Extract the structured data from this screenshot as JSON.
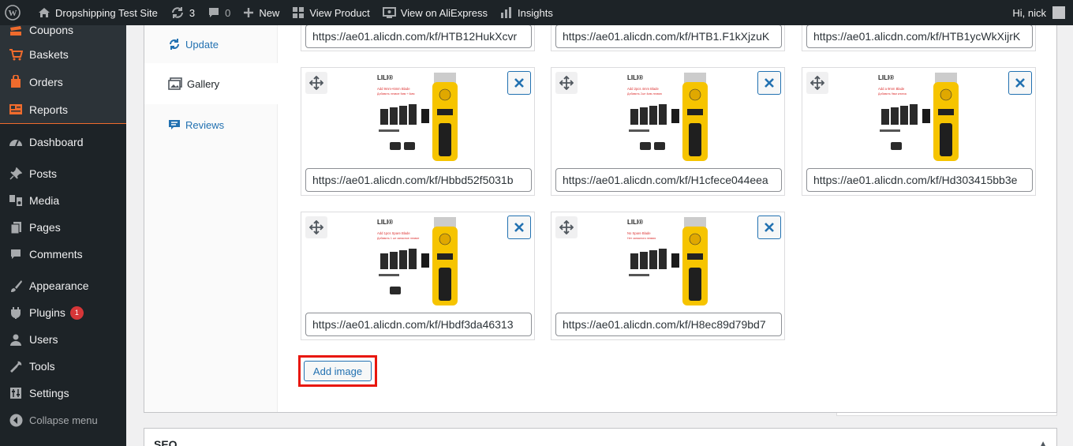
{
  "adminbar": {
    "wp_icon": "wordpress-logo-icon",
    "site_name": "Dropshipping Test Site",
    "updates_count": "3",
    "comments_count": "0",
    "new_label": "New",
    "view_product_label": "View Product",
    "view_aliexpress_label": "View on AliExpress",
    "insights_label": "Insights",
    "greeting": "Hi, nick"
  },
  "sidebar": {
    "woo_items": [
      {
        "label": "Coupons",
        "icon": "coupon-icon"
      },
      {
        "label": "Baskets",
        "icon": "basket-icon"
      },
      {
        "label": "Orders",
        "icon": "orders-icon"
      },
      {
        "label": "Reports",
        "icon": "reports-icon"
      }
    ],
    "dashboard": "Dashboard",
    "posts": "Posts",
    "media": "Media",
    "pages": "Pages",
    "comments": "Comments",
    "appearance": "Appearance",
    "plugins": "Plugins",
    "plugins_badge": "1",
    "users": "Users",
    "tools": "Tools",
    "settings": "Settings",
    "collapse": "Collapse menu"
  },
  "tabs": {
    "update": "Update",
    "gallery": "Gallery",
    "reviews": "Reviews"
  },
  "gallery": {
    "top_urls": [
      "https://ae01.alicdn.com/kf/HTB12HukXcvr",
      "https://ae01.alicdn.com/kf/HTB1.F1kXjzuK",
      "https://ae01.alicdn.com/kf/HTB1ycWkXijrK"
    ],
    "cards": [
      {
        "url": "https://ae01.alicdn.com/kf/Hbbd52f5031b",
        "brand": "LILI®",
        "caption": "Add 9mm+6mm Blade",
        "caption2": "Добавить лезвие 9мм + 6мм"
      },
      {
        "url": "https://ae01.alicdn.com/kf/H1cfece044eea",
        "brand": "LILI®",
        "caption": "Add 2pcs 4mm Blade",
        "caption2": "Добавить 2шт 4мм лезвия"
      },
      {
        "url": "https://ae01.alicdn.com/kf/Hd303415bb3e",
        "brand": "LILI®",
        "caption": "Add a 9mm Blade",
        "caption2": "Добавить 9мм клинок"
      },
      {
        "url": "https://ae01.alicdn.com/kf/Hbdf3da46313",
        "brand": "LILI®",
        "caption": "Add 1pcs Spare Blade",
        "caption2": "Добавить 1 шт запасное лезвие"
      },
      {
        "url": "https://ae01.alicdn.com/kf/H8ec89d79bd7",
        "brand": "LILI®",
        "caption": "No Spare Blade",
        "caption2": "Нет запасного лезвия"
      }
    ],
    "add_image": "Add image"
  },
  "seo": {
    "title": "SEO"
  },
  "colors": {
    "admin_dark": "#1d2327",
    "accent_blue": "#2271b1",
    "woo_orange": "#ef6b2d",
    "highlight_red": "#e8170e"
  }
}
